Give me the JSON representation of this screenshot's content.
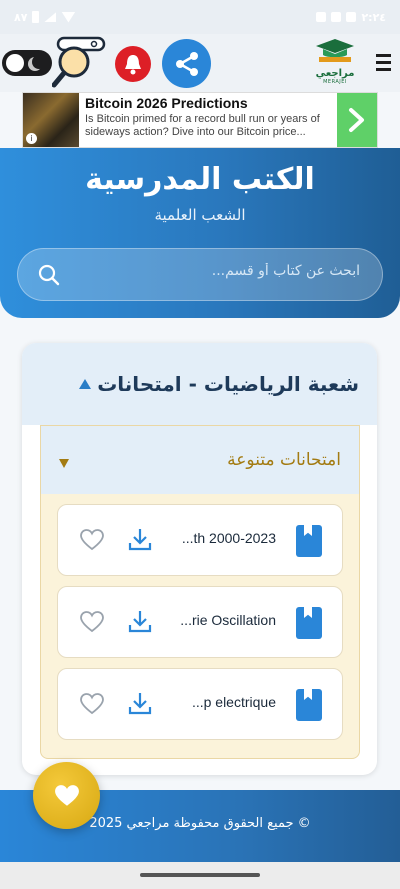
{
  "status_bar": {
    "battery_text": "٨٧",
    "time": "٢:٢٤"
  },
  "header": {
    "logo_text": "مراجعي",
    "logo_subtext": "MERAJEI"
  },
  "ad": {
    "title": "Bitcoin 2026 Predictions",
    "description": "Is Bitcoin primed for a record bull run or years of sideways action? Dive into our Bitcoin price..."
  },
  "hero": {
    "title": "الكتب المدرسية",
    "subtitle": "الشعب العلمية",
    "search_placeholder": "ابحث عن كتاب أو قسم..."
  },
  "section": {
    "title": "شعبة الرياضيات - امتحانات",
    "subsection": {
      "title": "امتحانات متنوعة",
      "files": [
        {
          "name": "...th 2000-2023"
        },
        {
          "name": "...rie Oscillation"
        },
        {
          "name": "...p electrique"
        }
      ]
    }
  },
  "footer": {
    "copyright": "© جميع الحقوق محفوظة مراجعي 2025"
  },
  "colors": {
    "accent": "#2a86d8",
    "gold": "#a37b12",
    "fab": "#e5b81f",
    "bell": "#dd1f26"
  }
}
